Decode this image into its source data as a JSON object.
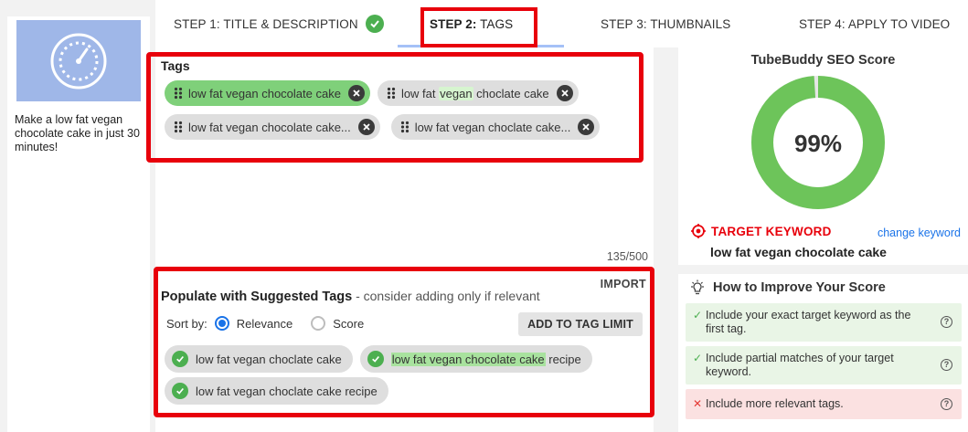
{
  "steps": [
    {
      "label": "STEP 1: TITLE & DESCRIPTION",
      "complete": true
    },
    {
      "label_bold": "STEP 2:",
      "label_rest": " TAGS",
      "active": true
    },
    {
      "label": "STEP 3: THUMBNAILS"
    },
    {
      "label": "STEP 4: APPLY TO VIDEO"
    }
  ],
  "video": {
    "title": "Make a low fat vegan chocolate cake in just 30 minutes!",
    "thumbnail_icon": "speedometer-icon"
  },
  "tags": {
    "label": "Tags",
    "items": [
      {
        "pre": "low fat vegan chocolate cake",
        "hl": "",
        "post": "",
        "active": true
      },
      {
        "pre": "low fat ",
        "hl": "vegan",
        "post": " choclate cake",
        "active": false
      },
      {
        "pre": "low fat vegan chocolate cake...",
        "hl": "",
        "post": "",
        "active": false
      },
      {
        "pre": "low fat vegan choclate cake...",
        "hl": "",
        "post": "",
        "active": false
      }
    ],
    "count": "135/500"
  },
  "suggested": {
    "import_label": "IMPORT",
    "title": "Populate with Suggested Tags",
    "subtitle": " - consider adding only if relevant",
    "sort_label": "Sort by:",
    "sort_options": [
      "Relevance",
      "Score"
    ],
    "sort_selected": "Relevance",
    "add_button": "ADD TO TAG LIMIT",
    "items": [
      {
        "hl": "low fat vegan choclate cake",
        "post": ""
      },
      {
        "hl": "low fat vegan chocolate cake",
        "post": " recipe"
      },
      {
        "hl": "low fat vegan choclate cake",
        "post": " recipe"
      }
    ]
  },
  "score": {
    "title": "TubeBuddy SEO Score",
    "value": "99%",
    "fraction": 0.99,
    "accent": "#6dc45a",
    "target_label": "TARGET KEYWORD",
    "change_label": "change keyword",
    "target_value": "low fat vegan chocolate cake"
  },
  "improve": {
    "title": "How to Improve Your Score",
    "tips": [
      {
        "text": "Include your exact target keyword as the first tag.",
        "status": "good"
      },
      {
        "text": "Include partial matches of your target keyword.",
        "status": "good"
      },
      {
        "text": "Include more relevant tags.",
        "status": "bad"
      }
    ]
  }
}
